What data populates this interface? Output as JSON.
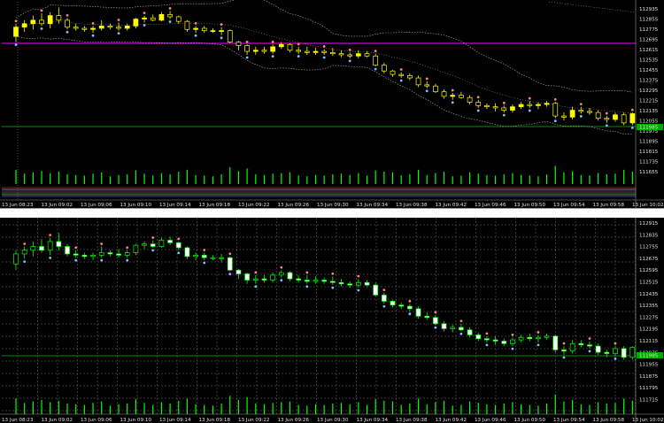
{
  "colors": {
    "background": "#000000",
    "grid": "#707070",
    "bull_body_top": "#ffff00",
    "bear_body_top": "#000000",
    "bull_body_bottom": "#000000",
    "bear_body_bottom": "#ffffff",
    "candle_outline_bottom": "#00ff00",
    "bollinger": "#b0b0b0",
    "magenta_level": "#ff00ff",
    "green_level": "#00c000",
    "volume": "#00ff00",
    "price_tag": "#00aa00"
  },
  "top_panel": {
    "price_axis": [
      "112935",
      "112855",
      "112775",
      "112695",
      "112615",
      "112535",
      "112455",
      "112375",
      "112295",
      "112215",
      "112135",
      "112055",
      "111975",
      "111895",
      "111815",
      "111735",
      "111655"
    ],
    "current_price_tag": "111985",
    "time_labels": [
      "13 Jun 08:23",
      "13 Jun 09:02",
      "13 Jun 09:06",
      "13 Jun 09:10",
      "13 Jun 09:14",
      "13 Jun 09:18",
      "13 Jun 09:22",
      "13 Jun 09:26",
      "13 Jun 09:30",
      "13 Jun 09:34",
      "13 Jun 09:38",
      "13 Jun 09:42",
      "13 Jun 09:46",
      "13 Jun 09:50",
      "13 Jun 09:54",
      "13 Jun 09:58",
      "13 Jun 10:02"
    ]
  },
  "bottom_panel": {
    "price_axis": [
      "112915",
      "112835",
      "112755",
      "112675",
      "112595",
      "112515",
      "112435",
      "112355",
      "112275",
      "112195",
      "112115",
      "112035",
      "111955",
      "111875",
      "111795",
      "111715"
    ],
    "current_price_tag": "111985",
    "time_labels": [
      "13 Jun 08:23",
      "13 Jun 09:02",
      "13 Jun 09:06",
      "13 Jun 09:10",
      "13 Jun 09:14",
      "13 Jun 09:18",
      "13 Jun 09:22",
      "13 Jun 09:26",
      "13 Jun 09:30",
      "13 Jun 09:34",
      "13 Jun 09:38",
      "13 Jun 09:42",
      "13 Jun 09:46",
      "13 Jun 09:50",
      "13 Jun 09:54",
      "13 Jun 09:58",
      "13 Jun 10:02"
    ]
  },
  "chart_data": {
    "type": "candlestick",
    "title": "",
    "candles": [
      {
        "o": 112650,
        "h": 112760,
        "l": 112600,
        "c": 112730,
        "v": 22
      },
      {
        "o": 112730,
        "h": 112790,
        "l": 112690,
        "c": 112760,
        "v": 16
      },
      {
        "o": 112760,
        "h": 112830,
        "l": 112710,
        "c": 112790,
        "v": 18
      },
      {
        "o": 112790,
        "h": 112850,
        "l": 112740,
        "c": 112760,
        "v": 20
      },
      {
        "o": 112760,
        "h": 112860,
        "l": 112720,
        "c": 112830,
        "v": 17
      },
      {
        "o": 112830,
        "h": 112900,
        "l": 112760,
        "c": 112790,
        "v": 19
      },
      {
        "o": 112790,
        "h": 112810,
        "l": 112710,
        "c": 112730,
        "v": 15
      },
      {
        "o": 112730,
        "h": 112760,
        "l": 112700,
        "c": 112720,
        "v": 14
      },
      {
        "o": 112720,
        "h": 112740,
        "l": 112690,
        "c": 112710,
        "v": 13
      },
      {
        "o": 112710,
        "h": 112740,
        "l": 112680,
        "c": 112720,
        "v": 16
      },
      {
        "o": 112720,
        "h": 112790,
        "l": 112700,
        "c": 112740,
        "v": 18
      },
      {
        "o": 112740,
        "h": 112760,
        "l": 112710,
        "c": 112730,
        "v": 12
      },
      {
        "o": 112730,
        "h": 112770,
        "l": 112700,
        "c": 112720,
        "v": 14
      },
      {
        "o": 112720,
        "h": 112760,
        "l": 112700,
        "c": 112740,
        "v": 15
      },
      {
        "o": 112740,
        "h": 112810,
        "l": 112720,
        "c": 112800,
        "v": 21
      },
      {
        "o": 112800,
        "h": 112830,
        "l": 112770,
        "c": 112810,
        "v": 16
      },
      {
        "o": 112810,
        "h": 112840,
        "l": 112780,
        "c": 112790,
        "v": 13
      },
      {
        "o": 112790,
        "h": 112860,
        "l": 112780,
        "c": 112840,
        "v": 17
      },
      {
        "o": 112840,
        "h": 112870,
        "l": 112800,
        "c": 112820,
        "v": 15
      },
      {
        "o": 112820,
        "h": 112830,
        "l": 112760,
        "c": 112780,
        "v": 19
      },
      {
        "o": 112780,
        "h": 112790,
        "l": 112690,
        "c": 112710,
        "v": 22
      },
      {
        "o": 112710,
        "h": 112740,
        "l": 112680,
        "c": 112720,
        "v": 14
      },
      {
        "o": 112720,
        "h": 112740,
        "l": 112680,
        "c": 112700,
        "v": 13
      },
      {
        "o": 112700,
        "h": 112720,
        "l": 112680,
        "c": 112700,
        "v": 12
      },
      {
        "o": 112700,
        "h": 112730,
        "l": 112660,
        "c": 112700,
        "v": 15
      },
      {
        "o": 112700,
        "h": 112710,
        "l": 112590,
        "c": 112600,
        "v": 26
      },
      {
        "o": 112600,
        "h": 112610,
        "l": 112530,
        "c": 112570,
        "v": 20
      },
      {
        "o": 112570,
        "h": 112580,
        "l": 112490,
        "c": 112520,
        "v": 24
      },
      {
        "o": 112520,
        "h": 112560,
        "l": 112490,
        "c": 112530,
        "v": 15
      },
      {
        "o": 112530,
        "h": 112560,
        "l": 112500,
        "c": 112520,
        "v": 14
      },
      {
        "o": 112520,
        "h": 112580,
        "l": 112500,
        "c": 112560,
        "v": 16
      },
      {
        "o": 112560,
        "h": 112600,
        "l": 112540,
        "c": 112580,
        "v": 17
      },
      {
        "o": 112580,
        "h": 112590,
        "l": 112510,
        "c": 112530,
        "v": 18
      },
      {
        "o": 112530,
        "h": 112560,
        "l": 112500,
        "c": 112520,
        "v": 13
      },
      {
        "o": 112520,
        "h": 112560,
        "l": 112490,
        "c": 112510,
        "v": 12
      },
      {
        "o": 112510,
        "h": 112550,
        "l": 112490,
        "c": 112520,
        "v": 14
      },
      {
        "o": 112520,
        "h": 112540,
        "l": 112490,
        "c": 112510,
        "v": 13
      },
      {
        "o": 112510,
        "h": 112550,
        "l": 112480,
        "c": 112500,
        "v": 15
      },
      {
        "o": 112500,
        "h": 112530,
        "l": 112470,
        "c": 112490,
        "v": 16
      },
      {
        "o": 112490,
        "h": 112510,
        "l": 112460,
        "c": 112480,
        "v": 14
      },
      {
        "o": 112480,
        "h": 112530,
        "l": 112460,
        "c": 112500,
        "v": 17
      },
      {
        "o": 112500,
        "h": 112520,
        "l": 112470,
        "c": 112480,
        "v": 13
      },
      {
        "o": 112480,
        "h": 112500,
        "l": 112390,
        "c": 112400,
        "v": 21
      },
      {
        "o": 112400,
        "h": 112420,
        "l": 112330,
        "c": 112350,
        "v": 19
      },
      {
        "o": 112350,
        "h": 112360,
        "l": 112300,
        "c": 112320,
        "v": 18
      },
      {
        "o": 112320,
        "h": 112340,
        "l": 112290,
        "c": 112310,
        "v": 13
      },
      {
        "o": 112310,
        "h": 112330,
        "l": 112270,
        "c": 112290,
        "v": 15
      },
      {
        "o": 112290,
        "h": 112310,
        "l": 112210,
        "c": 112230,
        "v": 22
      },
      {
        "o": 112230,
        "h": 112260,
        "l": 112200,
        "c": 112220,
        "v": 14
      },
      {
        "o": 112220,
        "h": 112240,
        "l": 112160,
        "c": 112170,
        "v": 17
      },
      {
        "o": 112170,
        "h": 112190,
        "l": 112110,
        "c": 112130,
        "v": 19
      },
      {
        "o": 112130,
        "h": 112160,
        "l": 112100,
        "c": 112140,
        "v": 12
      },
      {
        "o": 112140,
        "h": 112170,
        "l": 112110,
        "c": 112120,
        "v": 13
      },
      {
        "o": 112120,
        "h": 112140,
        "l": 112060,
        "c": 112080,
        "v": 18
      },
      {
        "o": 112080,
        "h": 112100,
        "l": 112030,
        "c": 112050,
        "v": 16
      },
      {
        "o": 112050,
        "h": 112070,
        "l": 112020,
        "c": 112040,
        "v": 14
      },
      {
        "o": 112040,
        "h": 112070,
        "l": 112000,
        "c": 112030,
        "v": 13
      },
      {
        "o": 112030,
        "h": 112050,
        "l": 111990,
        "c": 112010,
        "v": 15
      },
      {
        "o": 112010,
        "h": 112060,
        "l": 111990,
        "c": 112040,
        "v": 17
      },
      {
        "o": 112040,
        "h": 112080,
        "l": 112020,
        "c": 112060,
        "v": 14
      },
      {
        "o": 112060,
        "h": 112090,
        "l": 112030,
        "c": 112050,
        "v": 13
      },
      {
        "o": 112050,
        "h": 112080,
        "l": 112020,
        "c": 112060,
        "v": 12
      },
      {
        "o": 112060,
        "h": 112090,
        "l": 112040,
        "c": 112070,
        "v": 15
      },
      {
        "o": 112070,
        "h": 112080,
        "l": 111940,
        "c": 111960,
        "v": 28
      },
      {
        "o": 111960,
        "h": 111990,
        "l": 111920,
        "c": 111950,
        "v": 18
      },
      {
        "o": 111950,
        "h": 112040,
        "l": 111930,
        "c": 112010,
        "v": 20
      },
      {
        "o": 112010,
        "h": 112040,
        "l": 111980,
        "c": 112000,
        "v": 14
      },
      {
        "o": 112000,
        "h": 112030,
        "l": 111970,
        "c": 111990,
        "v": 13
      },
      {
        "o": 111990,
        "h": 112010,
        "l": 111920,
        "c": 111940,
        "v": 17
      },
      {
        "o": 111940,
        "h": 111960,
        "l": 111900,
        "c": 111930,
        "v": 15
      },
      {
        "o": 111930,
        "h": 111990,
        "l": 111910,
        "c": 111970,
        "v": 16
      },
      {
        "o": 111970,
        "h": 111990,
        "l": 111880,
        "c": 111900,
        "v": 22
      },
      {
        "o": 111900,
        "h": 111990,
        "l": 111880,
        "c": 111980,
        "v": 19
      }
    ],
    "price_range": [
      111600,
      112950
    ],
    "overlays": [
      "bollinger_bands"
    ]
  }
}
